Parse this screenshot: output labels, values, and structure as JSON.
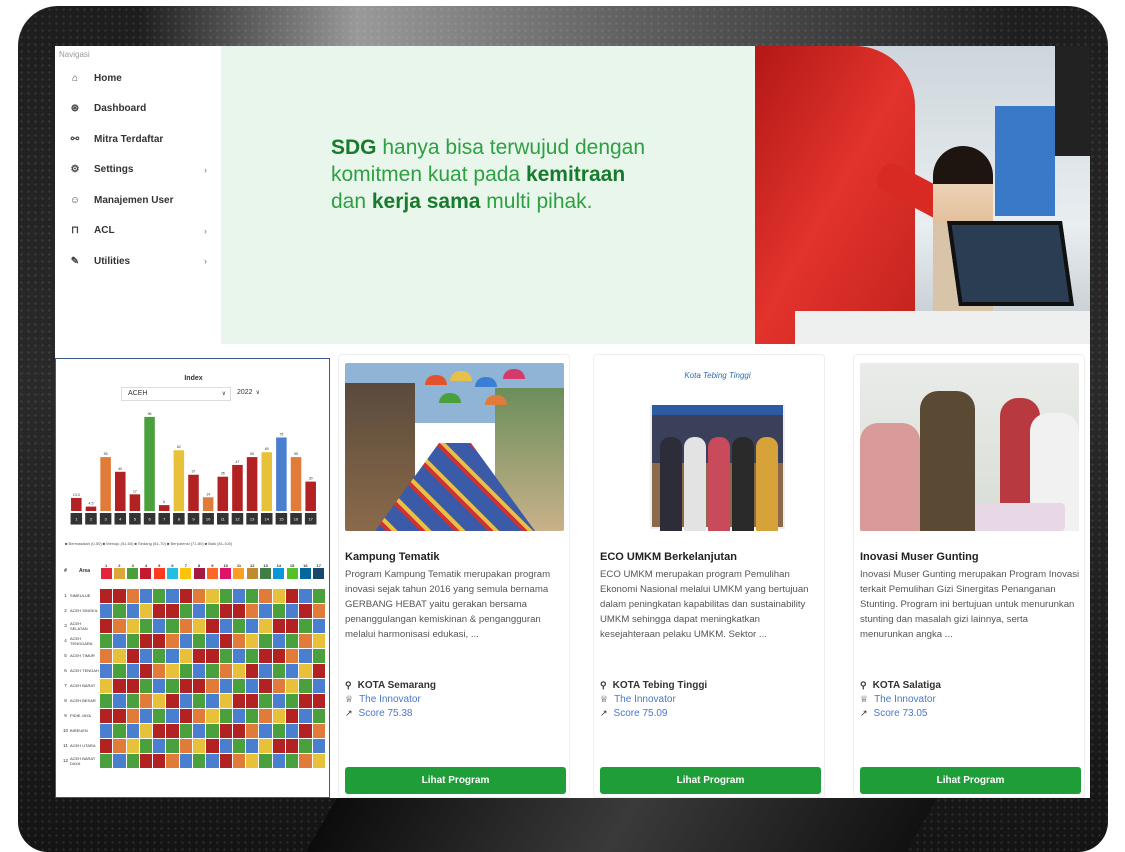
{
  "sidebar": {
    "header": "Navigasi",
    "items": [
      {
        "label": "Home",
        "icon": "home-icon",
        "glyph": "⌂",
        "chevron": false
      },
      {
        "label": "Dashboard",
        "icon": "dashboard-icon",
        "glyph": "⊛",
        "chevron": false
      },
      {
        "label": "Mitra Terdaftar",
        "icon": "partners-icon",
        "glyph": "⚯",
        "chevron": false
      },
      {
        "label": "Settings",
        "icon": "gear-icon",
        "glyph": "⚙",
        "chevron": true
      },
      {
        "label": "Manajemen User",
        "icon": "users-icon",
        "glyph": "☺",
        "chevron": false
      },
      {
        "label": "ACL",
        "icon": "lock-icon",
        "glyph": "⊓",
        "chevron": true
      },
      {
        "label": "Utilities",
        "icon": "wrench-icon",
        "glyph": "✎",
        "chevron": true
      }
    ]
  },
  "hero": {
    "line1_bold": "SDG",
    "line1_rest": " hanya bisa terwujud dengan",
    "line2_pre": "komitmen kuat pada ",
    "line2_bold": "kemitraan",
    "line3_pre": "dan ",
    "line3_bold": "kerja sama",
    "line3_rest": " multi pihak."
  },
  "index_widget": {
    "title": "Index",
    "region": "ACEH",
    "year": "2022",
    "chart_data": {
      "type": "bar",
      "title": "Index",
      "categories": [
        "1",
        "2",
        "3",
        "4",
        "5",
        "6",
        "7",
        "8",
        "9",
        "10",
        "11",
        "12",
        "13",
        "14",
        "15",
        "16",
        "17"
      ],
      "values": [
        13.3,
        4.5,
        55,
        40,
        17,
        96,
        6,
        62,
        37,
        14,
        35,
        47,
        55,
        60,
        75,
        55,
        30
      ],
      "colors": [
        "#b22222",
        "#b22222",
        "#e07b39",
        "#b22222",
        "#b22222",
        "#4aa03c",
        "#b22222",
        "#e8c13a",
        "#b22222",
        "#e07b39",
        "#b22222",
        "#b22222",
        "#b22222",
        "#e8c13a",
        "#4a7fcf",
        "#e07b39",
        "#b22222"
      ],
      "ylim": [
        0,
        100
      ],
      "legend": "top-bottom",
      "legend_text": "■ Bermasalah (0-50)  ■ Menuju (51-60)  ■ Sedang (61-70)  ■ Berpotensi (71-80)  ■ Baik (81-100)"
    },
    "table": {
      "col_no": "#",
      "col_area": "Area",
      "goals": [
        "1",
        "2",
        "3",
        "4",
        "5",
        "6",
        "7",
        "8",
        "9",
        "10",
        "11",
        "12",
        "13",
        "14",
        "15",
        "16",
        "17"
      ],
      "rows": [
        {
          "no": "1",
          "area": "SIMEULUE"
        },
        {
          "no": "2",
          "area": "ACEH SINGKIL"
        },
        {
          "no": "3",
          "area": "ACEH SELATAN"
        },
        {
          "no": "4",
          "area": "ACEH TENGGARA"
        },
        {
          "no": "5",
          "area": "ACEH TIMUR"
        },
        {
          "no": "6",
          "area": "ACEH TENGAH"
        },
        {
          "no": "7",
          "area": "ACEH BARAT"
        },
        {
          "no": "8",
          "area": "ACEH BESAR"
        },
        {
          "no": "9",
          "area": "PIDIE JAYA"
        },
        {
          "no": "10",
          "area": "BIREUEN"
        },
        {
          "no": "11",
          "area": "ACEH UTARA"
        },
        {
          "no": "12",
          "area": "ACEH BARAT DAYA"
        }
      ]
    }
  },
  "cards": [
    {
      "title": "Kampung Tematik",
      "desc": "Program Kampung Tematik merupakan program inovasi sejak tahun 2016 yang semula bernama GERBANG HEBAT yaitu gerakan bersama penanggulangan kemiskinan & pengangguran melalui harmonisasi edukasi, ...",
      "location": "KOTA Semarang",
      "award": "The Innovator",
      "score": "Score 75.38",
      "button": "Lihat Program"
    },
    {
      "title": "ECO UMKM Berkelanjutan",
      "desc": "ECO UMKM merupakan program Pemulihan Ekonomi Nasional melalui UMKM yang bertujuan dalam peningkatan kapabilitas dan sustainability UMKM sehingga dapat meningkatkan kesejahteraan pelaku UMKM. Sektor ...",
      "location": "KOTA Tebing Tinggi",
      "award": "The Innovator",
      "score": "Score 75.09",
      "button": "Lihat Program",
      "image_caption": "Kota Tebing Tinggi"
    },
    {
      "title": "Inovasi Muser Gunting",
      "desc": "Inovasi Muser Gunting merupakan Program Inovasi terkait Pemulihan Gizi Sinergitas Penanganan Stunting. Program ini bertujuan untuk menurunkan stunting dan masalah gizi lainnya, serta menurunkan angka ...",
      "location": "KOTA Salatiga",
      "award": "The Innovator",
      "score": "Score 73.05",
      "button": "Lihat Program"
    }
  ],
  "colors": {
    "primary_green": "#1f9d38",
    "hero_bg": "#e9f6ec",
    "link_blue": "#4a78c8"
  }
}
